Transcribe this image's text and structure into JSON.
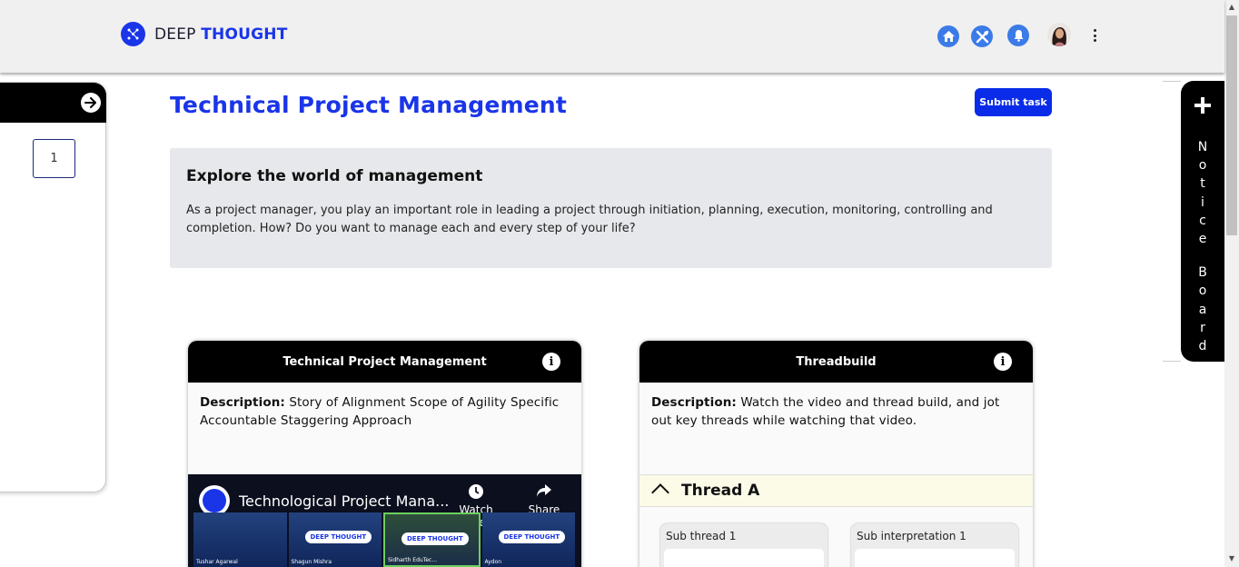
{
  "header": {
    "logo_prefix": "DEEP",
    "logo_suffix": "THOUGHT",
    "icons": [
      "home-icon",
      "tools-icon",
      "bell-icon",
      "avatar",
      "more-icon"
    ]
  },
  "sidebar": {
    "page_number": "1"
  },
  "main": {
    "title": "Technical Project Management",
    "submit_label": "Submit task",
    "intro": {
      "heading": "Explore the world of management",
      "body": "As a project manager, you play an important role in leading a project through initiation, planning, execution, monitoring, controlling and completion. How? Do you want to manage each and every step of your life?"
    }
  },
  "notice_board": {
    "label": "Notice Board"
  },
  "cards": [
    {
      "title": "Technical Project Management",
      "desc_label": "Description:",
      "desc_text": " Story of Alignment Scope of Agility Specific Accountable Staggering Approach",
      "video": {
        "title": "Technological Project Mana...",
        "watch_later": "Watch Later",
        "share": "Share",
        "thumb_badge": "DEEP THOUGHT",
        "thumbnails": [
          "Tushar Agarwal",
          "Shagun Mishra",
          "Sidharth EduTec...",
          "Aydon"
        ]
      }
    },
    {
      "title": "Threadbuild",
      "desc_label": "Description:",
      "desc_text": " Watch the video and thread build, and jot out key threads while watching that video.",
      "thread": {
        "title": "Thread A",
        "sub_thread": "Sub thread 1",
        "sub_interpretation": "Sub interpretation 1"
      }
    }
  ],
  "colors": {
    "brand_blue": "#1a35e8",
    "header_bg": "#f0f0f0",
    "intro_bg": "#e6e8eb",
    "icon_blue": "#3b7be8"
  }
}
